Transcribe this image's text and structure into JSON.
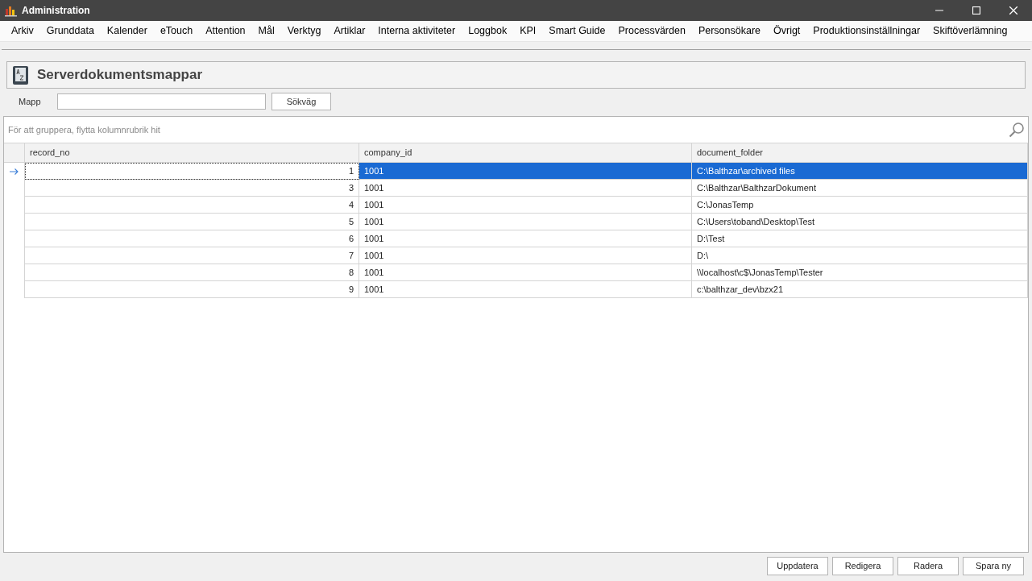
{
  "window": {
    "title": "Administration"
  },
  "menu": [
    "Arkiv",
    "Grunddata",
    "Kalender",
    "eTouch",
    "Attention",
    "Mål",
    "Verktyg",
    "Artiklar",
    "Interna aktiviteter",
    "Loggbok",
    "KPI",
    "Smart Guide",
    "Processvärden",
    "Personsökare",
    "Övrigt",
    "Produktionsinställningar",
    "Skiftöverlämning"
  ],
  "panel": {
    "title": "Serverdokumentsmappar"
  },
  "filter": {
    "label": "Mapp",
    "button": "Sökväg"
  },
  "grid": {
    "group_hint": "För att gruppera, flytta kolumnrubrik hit",
    "columns": [
      "record_no",
      "company_id",
      "document_folder"
    ],
    "rows": [
      {
        "selected": true,
        "cells": [
          "1",
          "1001",
          "C:\\Balthzar\\archived files"
        ]
      },
      {
        "selected": false,
        "cells": [
          "3",
          "1001",
          "C:\\Balthzar\\BalthzarDokument"
        ]
      },
      {
        "selected": false,
        "cells": [
          "4",
          "1001",
          "C:\\JonasTemp"
        ]
      },
      {
        "selected": false,
        "cells": [
          "5",
          "1001",
          "C:\\Users\\toband\\Desktop\\Test"
        ]
      },
      {
        "selected": false,
        "cells": [
          "6",
          "1001",
          "D:\\Test"
        ]
      },
      {
        "selected": false,
        "cells": [
          "7",
          "1001",
          "D:\\"
        ]
      },
      {
        "selected": false,
        "cells": [
          "8",
          "1001",
          "\\\\localhost\\c$\\JonasTemp\\Tester"
        ]
      },
      {
        "selected": false,
        "cells": [
          "9",
          "1001",
          "c:\\balthzar_dev\\bzx21"
        ]
      }
    ]
  },
  "buttons": [
    "Uppdatera",
    "Redigera",
    "Radera",
    "Spara ny"
  ]
}
